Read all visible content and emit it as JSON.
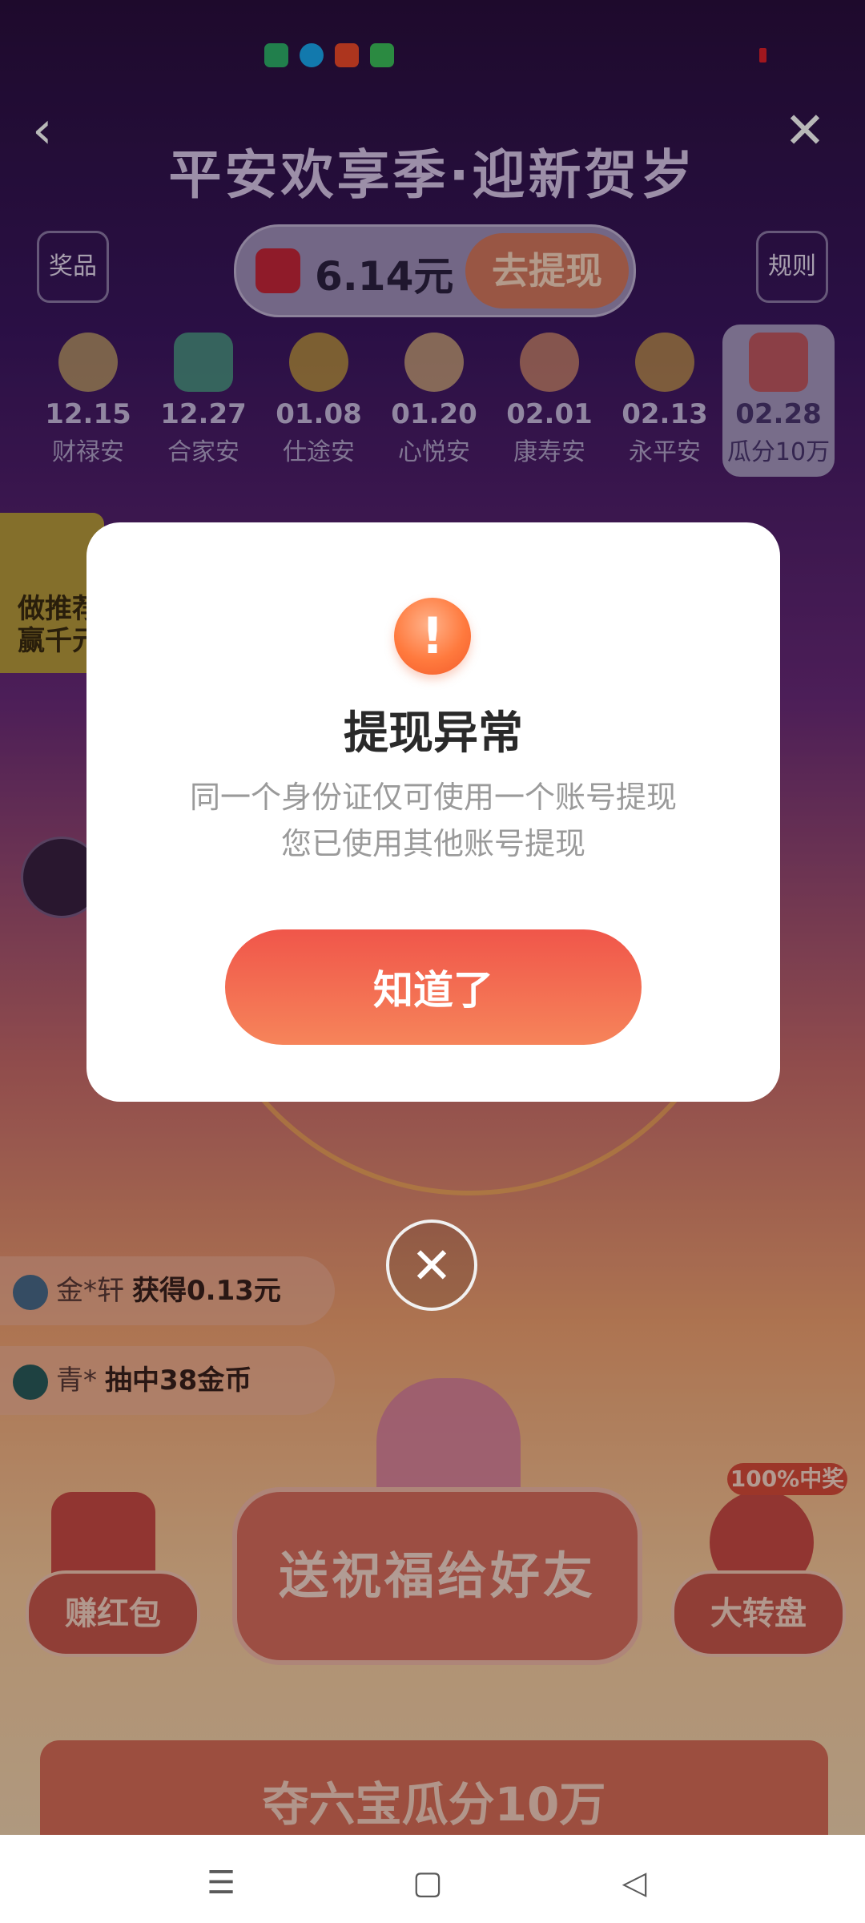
{
  "status_bar": {
    "app_icons": [
      {
        "name": "sim-app-icon",
        "color": "#2fb06a"
      },
      {
        "name": "qq-icon",
        "color": "#1aa8f0"
      },
      {
        "name": "video-app-icon",
        "color": "#f04a2a"
      },
      {
        "name": "message-app-icon",
        "color": "#3cbf5a"
      }
    ]
  },
  "page": {
    "title": "平安欢享季·迎新贺岁",
    "prizes_label": "奖品",
    "rules_label": "规则",
    "balance": "6.14元",
    "withdraw_label": "去提现",
    "calendar": [
      {
        "date": "12.15",
        "name": "财禄安"
      },
      {
        "date": "12.27",
        "name": "合家安"
      },
      {
        "date": "01.08",
        "name": "仕途安"
      },
      {
        "date": "01.20",
        "name": "心悦安"
      },
      {
        "date": "02.01",
        "name": "康寿安"
      },
      {
        "date": "02.13",
        "name": "永平安"
      },
      {
        "date": "02.28",
        "name": "瓜分10万"
      }
    ],
    "promo_text": "做推荐赢千元",
    "ticker": [
      {
        "user": "金*轩",
        "action": "获得0.13元"
      },
      {
        "user": "青*",
        "action": "抽中38金币"
      }
    ],
    "earn_red_packet": "赚红包",
    "wheel_badge": "100%中奖",
    "wheel": "大转盘",
    "send_blessing": "送祝福给好友",
    "bottom_banner": "夺六宝瓜分10万"
  },
  "dialog": {
    "title": "提现异常",
    "message_line1": "同一个身份证仅可使用一个账号提现",
    "message_line2": "您已使用其他账号提现",
    "ok_label": "知道了"
  },
  "navbar": {
    "menu_icon": "☰",
    "home_icon": "▢",
    "back_icon": "◁"
  }
}
